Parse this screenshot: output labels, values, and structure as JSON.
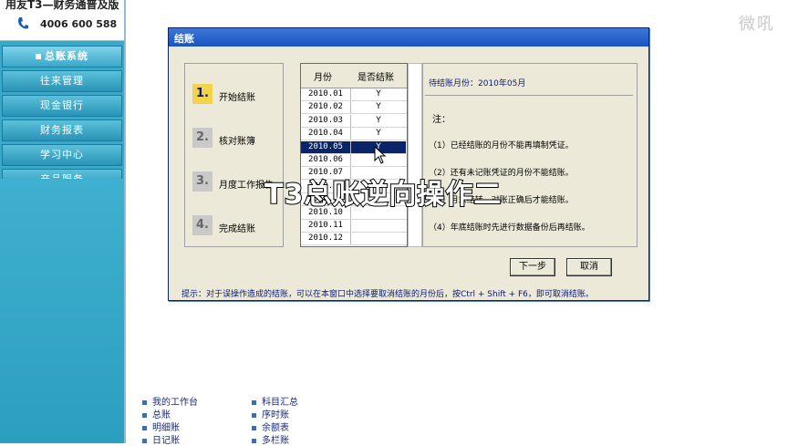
{
  "brand": {
    "title": "用友T3—财务通普及版",
    "phone": "4006 600 588"
  },
  "sidebar": {
    "items": [
      {
        "label": "总账系统",
        "active": true
      },
      {
        "label": "往来管理"
      },
      {
        "label": "现金银行"
      },
      {
        "label": "财务报表"
      },
      {
        "label": "学习中心"
      },
      {
        "label": "产品服务"
      }
    ]
  },
  "watermark": "微吼",
  "dialog": {
    "title": "结账",
    "steps": [
      {
        "num": "1.",
        "label": "开始结账",
        "active": true
      },
      {
        "num": "2.",
        "label": "核对账簿"
      },
      {
        "num": "3.",
        "label": "月度工作报告"
      },
      {
        "num": "4.",
        "label": "完成结账"
      }
    ],
    "table": {
      "headers": [
        "月份",
        "是否结账"
      ],
      "rows": [
        {
          "month": "2010.01",
          "closed": "Y"
        },
        {
          "month": "2010.02",
          "closed": "Y"
        },
        {
          "month": "2010.03",
          "closed": "Y"
        },
        {
          "month": "2010.04",
          "closed": "Y"
        },
        {
          "month": "2010.05",
          "closed": "Y",
          "selected": true
        },
        {
          "month": "2010.06",
          "closed": ""
        },
        {
          "month": "2010.07",
          "closed": ""
        },
        {
          "month": "2010.08",
          "closed": ""
        },
        {
          "month": "2010.09",
          "closed": ""
        },
        {
          "month": "2010.10",
          "closed": ""
        },
        {
          "month": "2010.11",
          "closed": ""
        },
        {
          "month": "2010.12",
          "closed": ""
        }
      ]
    },
    "info": {
      "pending": "待结账月份：2010年05月",
      "note_label": "注：",
      "notes": [
        "（1）已经结账的月份不能再填制凭证。",
        "（2）还有未记账凭证的月份不能结账。",
        "（3）月末结转、对账正确后才能结账。",
        "（4）年底结账时先进行数据备份后再结账。"
      ]
    },
    "buttons": {
      "next": "下一步",
      "cancel": "取消"
    },
    "hint": "提示：对于误操作造成的结账，可以在本窗口中选择要取消结账的月份后，按Ctrl + Shift + F6，即可取消结账。"
  },
  "caption": "T3总账逆向操作二",
  "quick_links": {
    "col1": [
      "我的工作台",
      "总账",
      "明细账",
      "日记账"
    ],
    "col2": [
      "科目汇总",
      "序时账",
      "余额表",
      "多栏账"
    ]
  }
}
